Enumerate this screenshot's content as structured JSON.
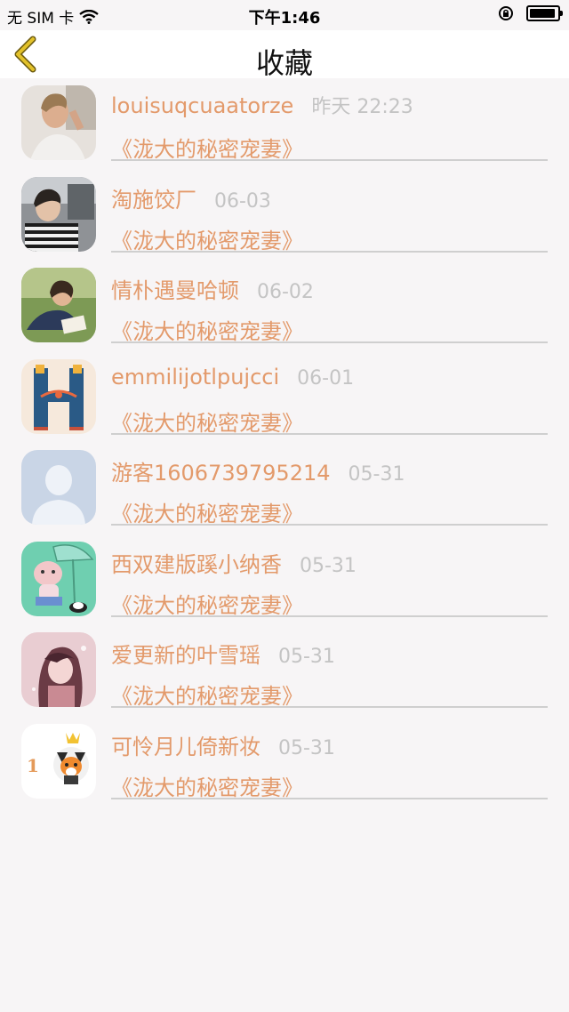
{
  "status_bar": {
    "carrier": "无 SIM 卡",
    "time": "下午1:46",
    "wifi_icon": "wifi-icon",
    "lock_icon": "orientation-lock-icon",
    "battery_icon": "battery-icon"
  },
  "nav": {
    "title": "收藏",
    "back_icon": "chevron-left-icon",
    "back_color": "#d9b200"
  },
  "colors": {
    "accent": "#e39a6b",
    "muted": "#c4c4c4",
    "background": "#f7f5f6"
  },
  "favorites": [
    {
      "name": "louisuqcuaatorze",
      "time": "昨天 22:23",
      "book": "《泷大的秘密宠妻》",
      "avatar": "photo-woman-avatar"
    },
    {
      "name": "淘施饺厂",
      "time": "06-03",
      "book": "《泷大的秘密宠妻》",
      "avatar": "photo-boy-striped-shirt-avatar"
    },
    {
      "name": "情朴遇曼哈顿",
      "time": "06-02",
      "book": "《泷大的秘密宠妻》",
      "avatar": "photo-woman-reading-avatar"
    },
    {
      "name": "emmilijotlpujcci",
      "time": "06-01",
      "book": "《泷大的秘密宠妻》",
      "avatar": "letter-h-illustration-avatar"
    },
    {
      "name": "游客1606739795214",
      "time": "05-31",
      "book": "《泷大的秘密宠妻》",
      "avatar": "default-person-avatar"
    },
    {
      "name": "西双建版蹊小纳香",
      "time": "05-31",
      "book": "《泷大的秘密宠妻》",
      "avatar": "cartoon-umbrella-avatar"
    },
    {
      "name": "爱更新的叶雪瑶",
      "time": "05-31",
      "book": "《泷大的秘密宠妻》",
      "avatar": "illustrated-girl-avatar"
    },
    {
      "name": "可怜月儿倚新妆",
      "time": "05-31",
      "book": "《泷大的秘密宠妻》",
      "avatar": "cartoon-fox-avatar"
    }
  ]
}
